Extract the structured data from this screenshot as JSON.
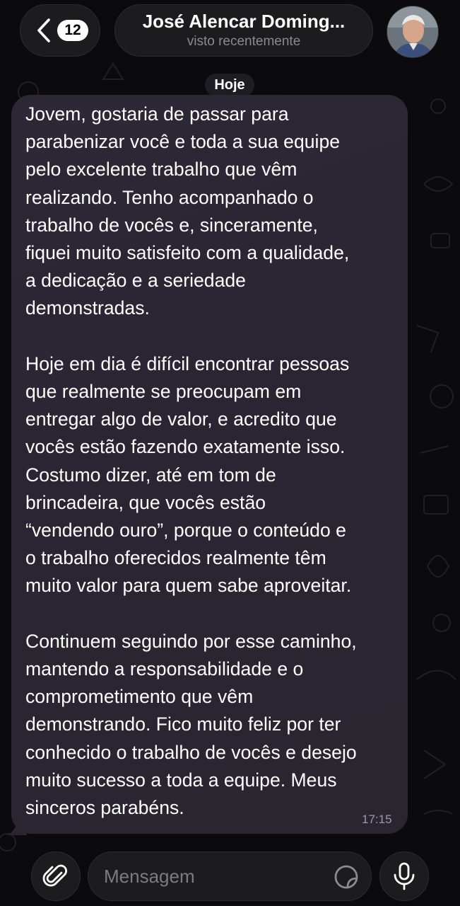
{
  "header": {
    "unread_count": "12",
    "contact_name": "José Alencar Doming...",
    "contact_status": "visto recentemente"
  },
  "chat": {
    "date_label": "Hoje",
    "message": {
      "text": "Jovem, gostaria de passar para\nparabenizar você e toda a sua equipe\npelo excelente trabalho que vêm\nrealizando. Tenho acompanhado o\ntrabalho de vocês e, sinceramente,\nfiquei muito satisfeito com a qualidade,\na dedicação e a seriedade\ndemonstradas.\n\nHoje em dia é difícil encontrar pessoas\nque realmente se preocupam em\nentregar algo de valor, e acredito que\nvocês estão fazendo exatamente isso.\nCostumo dizer, até em tom de\nbrincadeira, que vocês estão\n“vendendo ouro”, porque o conteúdo e\no trabalho oferecidos realmente têm\nmuito valor para quem sabe aproveitar.\n\nContinuem seguindo por esse caminho,\nmantendo a responsabilidade e o\ncomprometimento que vêm\ndemonstrando. Fico muito feliz por ter\nconhecido o trabalho de vocês e desejo\nmuito sucesso a toda a equipe. Meus\nsinceros parabéns.",
      "time": "17:15"
    }
  },
  "composer": {
    "placeholder": "Mensagem"
  },
  "icons": {
    "back": "chevron-left-icon",
    "attach": "paperclip-icon",
    "sticker": "sticker-icon",
    "mic": "microphone-icon"
  },
  "colors": {
    "background": "#0b0a0d",
    "bubble": "#2a2532",
    "pill": "#1c1c1f",
    "secondary_text": "#8a8a90"
  }
}
